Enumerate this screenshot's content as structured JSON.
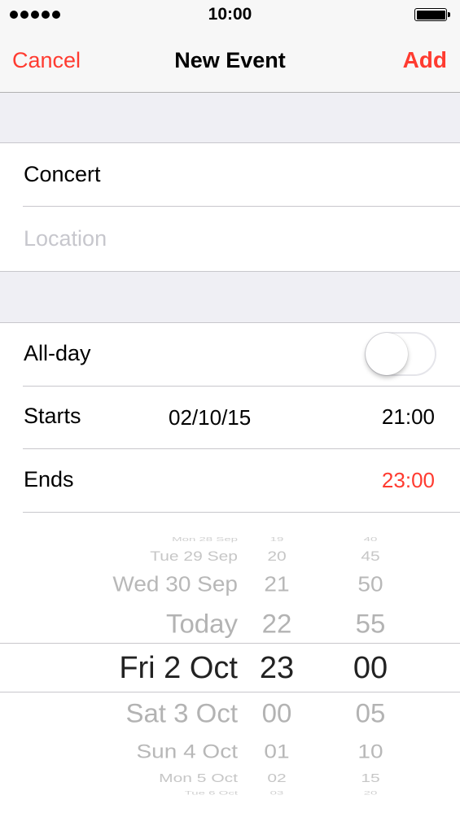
{
  "status_bar": {
    "time": "10:00"
  },
  "nav": {
    "cancel": "Cancel",
    "title": "New Event",
    "add": "Add"
  },
  "title_field": {
    "value": "Concert"
  },
  "location_field": {
    "placeholder": "Location"
  },
  "all_day": {
    "label": "All-day",
    "on": false
  },
  "starts": {
    "label": "Starts",
    "date": "02/10/15",
    "time": "21:00"
  },
  "ends": {
    "label": "Ends",
    "time": "23:00"
  },
  "picker": {
    "dates": [
      "Mon 28 Sep",
      "Tue 29 Sep",
      "Wed 30 Sep",
      "Today",
      "Fri 2 Oct",
      "Sat 3 Oct",
      "Sun 4 Oct",
      "Mon 5 Oct",
      "Tue 6 Oct"
    ],
    "hours": [
      "19",
      "20",
      "21",
      "22",
      "23",
      "00",
      "01",
      "02",
      "03"
    ],
    "minutes": [
      "40",
      "45",
      "50",
      "55",
      "00",
      "05",
      "10",
      "15",
      "20"
    ],
    "selected_index": 4
  },
  "colors": {
    "accent": "#ff3b30",
    "placeholder": "#c7c7cd",
    "separator": "#c8c7cc",
    "group_bg": "#efeff4"
  }
}
